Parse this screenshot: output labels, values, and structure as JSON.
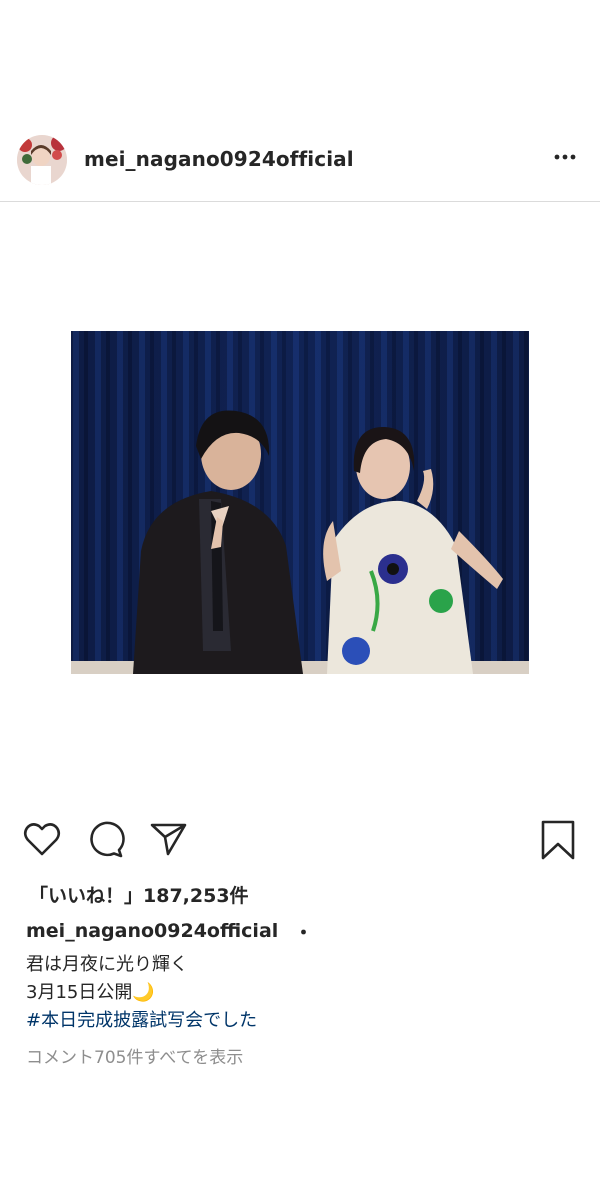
{
  "post": {
    "username": "mei_nagano0924official",
    "more_icon": "more-horizontal-icon",
    "photo_description_hidden": "",
    "actions": {
      "like_icon": "heart-icon",
      "comment_icon": "comment-icon",
      "share_icon": "send-icon",
      "save_icon": "bookmark-icon"
    },
    "likes_text": "「いいね！」187,253件",
    "caption": {
      "username": "mei_nagano0924official",
      "separator": "・",
      "lines": [
        "君は月夜に光り輝く",
        "3月15日公開🌙"
      ],
      "hashtag": "#本日完成披露試写会でした"
    },
    "view_comments": "コメント705件すべてを表示"
  },
  "colors": {
    "text": "#262626",
    "hashtag": "#003569",
    "muted": "#8e8e8e",
    "divider": "#dbdbdb",
    "curtain": "#0f1f4a"
  }
}
